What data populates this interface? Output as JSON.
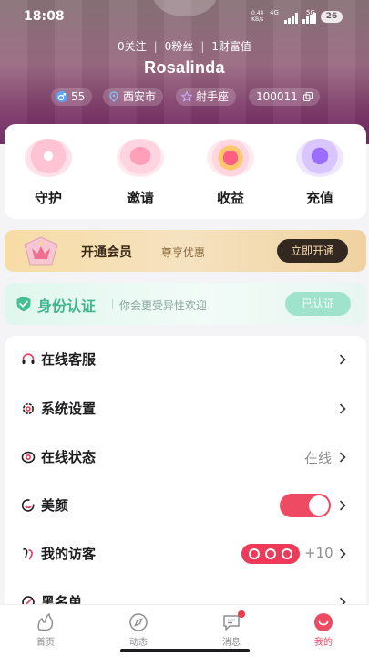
{
  "status": {
    "time": "18:08",
    "net_speed_top": "0.44",
    "net_speed_unit": "KB/s",
    "net_4g": "4G",
    "net_5g": "5G",
    "battery": "26"
  },
  "profile": {
    "stats": [
      "0关注",
      "0粉丝",
      "1财富值"
    ],
    "username": "Rosalinda",
    "chips": {
      "level": "55",
      "city": "西安市",
      "zodiac": "射手座",
      "id": "100011"
    }
  },
  "quick": [
    {
      "label": "守护",
      "icon": "blossom-icon"
    },
    {
      "label": "邀请",
      "icon": "petal-icon"
    },
    {
      "label": "收益",
      "icon": "heart-crown-icon"
    },
    {
      "label": "充值",
      "icon": "purple-shape-icon"
    }
  ],
  "vip": {
    "title": "开通会员",
    "subtitle": "尊享优惠",
    "button": "立即开通"
  },
  "identity": {
    "title": "身份认证",
    "subtitle": "你会更受异性欢迎",
    "button": "已认证"
  },
  "menu": [
    {
      "label": "在线客服",
      "icon": "headset-icon"
    },
    {
      "label": "系统设置",
      "icon": "gear-icon"
    },
    {
      "label": "在线状态",
      "icon": "status-ring-icon",
      "value": "在线"
    },
    {
      "label": "美颜",
      "icon": "smile-icon",
      "toggle_on": true
    },
    {
      "label": "我的访客",
      "icon": "footprint-icon",
      "extra": "+10"
    },
    {
      "label": "黑名单",
      "icon": "block-icon"
    }
  ],
  "tabs": [
    {
      "label": "首页",
      "icon": "home-icon"
    },
    {
      "label": "动态",
      "icon": "compass-icon"
    },
    {
      "label": "消息",
      "icon": "message-icon"
    },
    {
      "label": "我的",
      "icon": "me-icon",
      "active": true
    }
  ],
  "colors": {
    "accent": "#ef4a64",
    "identity_green": "#3fb690",
    "vip_dark": "#33281f"
  }
}
